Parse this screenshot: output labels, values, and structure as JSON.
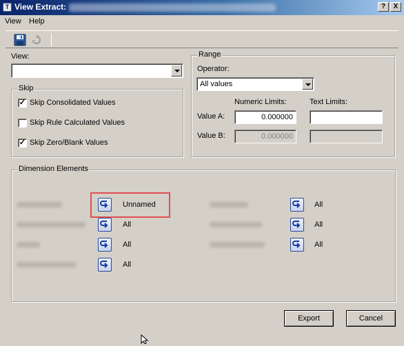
{
  "window": {
    "title": "View Extract:",
    "help_button": "?",
    "close_button": "X"
  },
  "menu": [
    {
      "label": "View"
    },
    {
      "label": "Help"
    }
  ],
  "toolbar": {
    "save_icon": "save-icon",
    "refresh_icon": "refresh-icon"
  },
  "view": {
    "label": "View:",
    "value": ""
  },
  "skip": {
    "title": "Skip",
    "options": [
      {
        "label": "Skip Consolidated Values",
        "checked": true
      },
      {
        "label": "Skip Rule Calculated Values",
        "checked": false
      },
      {
        "label": "Skip Zero/Blank Values",
        "checked": true
      }
    ]
  },
  "range": {
    "title": "Range",
    "operator_label": "Operator:",
    "operator_value": "All values",
    "numeric_header": "Numeric Limits:",
    "text_header": "Text Limits:",
    "value_a_label": "Value A:",
    "value_b_label": "Value B:",
    "value_a_numeric": "0.000000",
    "value_b_numeric": "0.000000",
    "value_a_text": "",
    "value_b_text": ""
  },
  "dimensions": {
    "title": "Dimension Elements",
    "left": [
      {
        "value": "Unnamed"
      },
      {
        "value": "All"
      },
      {
        "value": "All"
      },
      {
        "value": "All"
      }
    ],
    "right": [
      {
        "value": "All"
      },
      {
        "value": "All"
      },
      {
        "value": "All"
      }
    ]
  },
  "buttons": {
    "export": "Export",
    "cancel": "Cancel"
  }
}
